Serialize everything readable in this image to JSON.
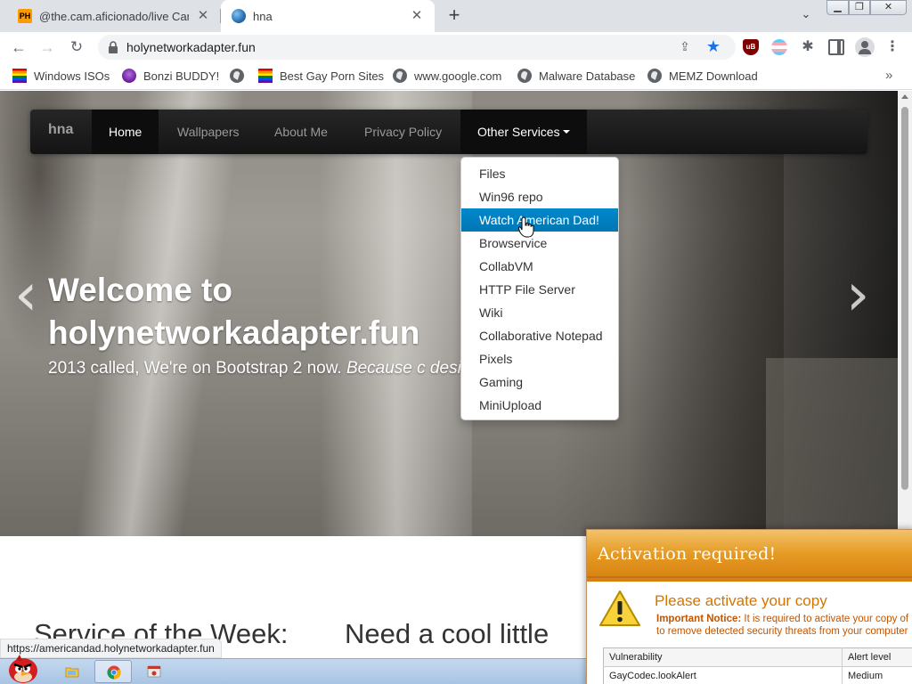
{
  "browser": {
    "tabs": [
      {
        "title": "@the.cam.aficionado/live Cam",
        "favicon": "PH",
        "active": false
      },
      {
        "title": "hna",
        "favicon": "globe-icon",
        "active": true
      }
    ],
    "url": "holynetworkadapter.fun",
    "bookmarks": [
      {
        "label": "Windows ISOs",
        "icon": "rainbow-flag-icon"
      },
      {
        "label": "Bonzi BUDDY!",
        "icon": "purple-ape-icon"
      },
      {
        "label": "",
        "icon": "globe-icon"
      },
      {
        "label": "Best Gay Porn Sites",
        "icon": "rainbow-flag-icon"
      },
      {
        "label": "www.google.com",
        "icon": "globe-icon"
      },
      {
        "label": "Malware Database",
        "icon": "globe-icon"
      },
      {
        "label": "MEMZ Download",
        "icon": "globe-icon"
      }
    ],
    "status_url": "https://americandad.holynetworkadapter.fun",
    "colors": {
      "star": "#1a73e8",
      "tabstrip": "#dee1e6"
    }
  },
  "page": {
    "navbar": {
      "brand": "hna",
      "items": [
        "Home",
        "Wallpapers",
        "About Me",
        "Privacy Policy"
      ],
      "dropdown_label": "Other Services",
      "active": "Home"
    },
    "dropdown_items": [
      "Files",
      "Win96 repo",
      "Watch American Dad!",
      "Browservice",
      "CollabVM",
      "HTTP File Server",
      "Wiki",
      "Collaborative Notepad",
      "Pixels",
      "Gaming",
      "MiniUpload"
    ],
    "dropdown_hovered": "Watch American Dad!",
    "hero": {
      "title": "Welcome to holynetworkadapter.fun",
      "subtitle_plain": "2013 called, We're on Bootstrap 2 now. ",
      "subtitle_italic": "Because c design kicks ass!"
    },
    "sections": {
      "service_week": "Service of the Week:",
      "need_cool": "Need a cool little"
    },
    "colors": {
      "dropdown_active": "#0088cc",
      "navbar": "#1b1b1b"
    }
  },
  "popup": {
    "title": "Activation required!",
    "heading": "Please activate your copy",
    "notice_bold": "Important Notice:",
    "notice_line1": " It is required to activate your copy of",
    "notice_line2": "to remove detected security threats from your computer",
    "table": {
      "headers": [
        "Vulnerability",
        "Alert level"
      ],
      "rows": [
        [
          "GayCodec.lookAlert",
          "Medium"
        ]
      ]
    },
    "colors": {
      "title_bar": "#e69b24",
      "heading": "#d37500"
    }
  },
  "taskbar": {
    "items": [
      "start-orb",
      "explorer-icon",
      "chrome-icon",
      "app-icon"
    ]
  }
}
